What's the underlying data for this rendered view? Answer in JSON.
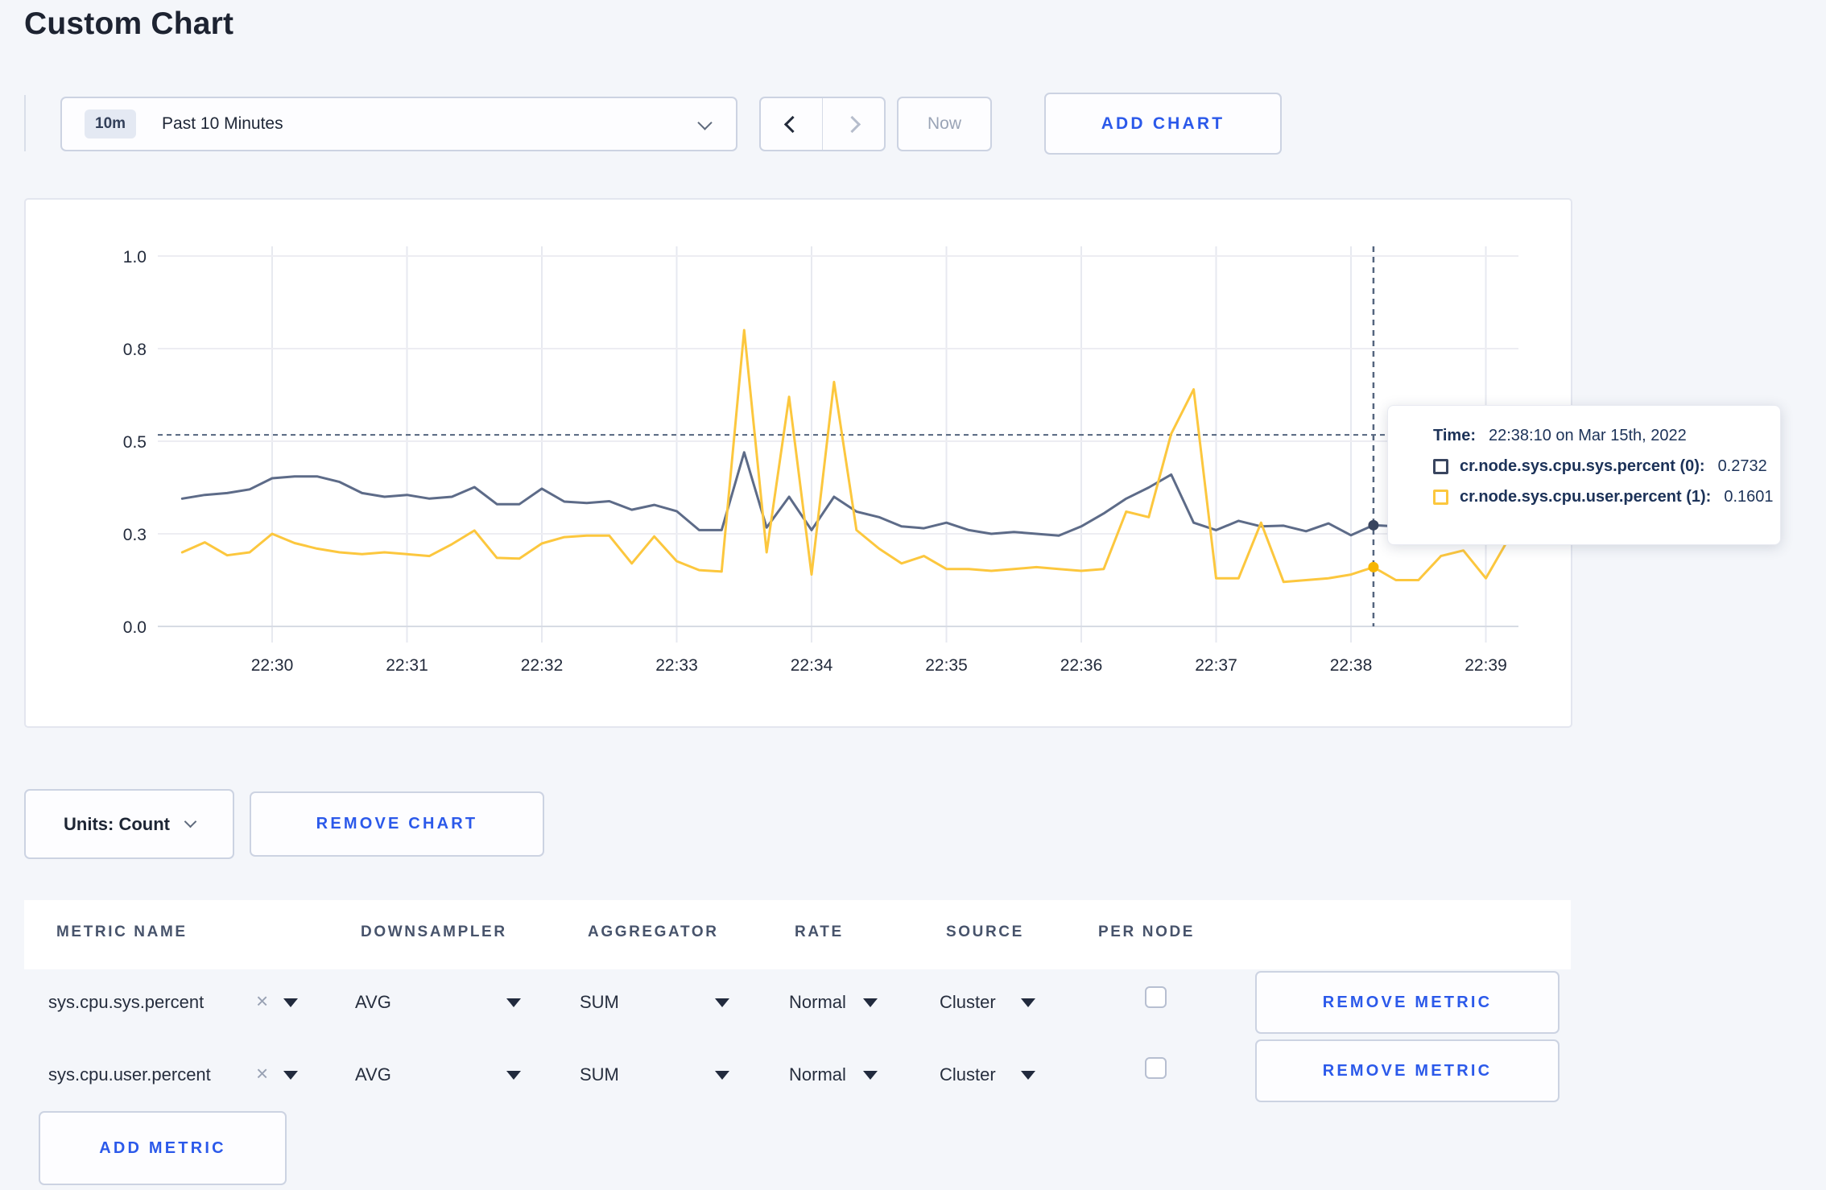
{
  "page": {
    "title": "Custom Chart"
  },
  "toolbar": {
    "time_badge": "10m",
    "time_label": "Past 10 Minutes",
    "prev_icon": "chevron-left",
    "next_icon": "chevron-right",
    "now_label": "Now",
    "add_chart_label": "ADD CHART"
  },
  "chart_footer": {
    "units_label": "Units: Count",
    "remove_chart_label": "REMOVE CHART"
  },
  "tooltip": {
    "time_label": "Time:",
    "time_value": "22:38:10 on Mar 15th, 2022",
    "series": [
      {
        "label": "cr.node.sys.cpu.sys.percent (0):",
        "value": "0.2732"
      },
      {
        "label": "cr.node.sys.cpu.user.percent (1):",
        "value": "0.1601"
      }
    ]
  },
  "metrics_table": {
    "headers": [
      "METRIC NAME",
      "DOWNSAMPLER",
      "AGGREGATOR",
      "RATE",
      "SOURCE",
      "PER NODE"
    ],
    "rows": [
      {
        "name": "sys.cpu.sys.percent",
        "downsampler": "AVG",
        "aggregator": "SUM",
        "rate": "Normal",
        "source": "Cluster",
        "per_node_checked": false
      },
      {
        "name": "sys.cpu.user.percent",
        "downsampler": "AVG",
        "aggregator": "SUM",
        "rate": "Normal",
        "source": "Cluster",
        "per_node_checked": false
      }
    ],
    "remove_metric_label": "REMOVE METRIC",
    "add_metric_label": "ADD METRIC"
  },
  "chart_data": {
    "type": "line",
    "title": "",
    "xlabel": "",
    "ylabel": "",
    "ylim": [
      0,
      1
    ],
    "x_start_time": "22:29:20",
    "x_step_seconds": 10,
    "x_ticks": [
      "22:30",
      "22:31",
      "22:32",
      "22:33",
      "22:34",
      "22:35",
      "22:36",
      "22:37",
      "22:38",
      "22:39"
    ],
    "y_ticks": [
      {
        "value": 0.0,
        "label": "0.0"
      },
      {
        "value": 0.25,
        "label": "0.3"
      },
      {
        "value": 0.5,
        "label": "0.5"
      },
      {
        "value": 0.75,
        "label": "0.8"
      },
      {
        "value": 1.0,
        "label": "1.0"
      }
    ],
    "grid": true,
    "legend_position": "tooltip-only",
    "series": [
      {
        "name": "cr.node.sys.cpu.sys.percent",
        "color": "#5d6b88",
        "dot_color": "#39455f",
        "values": [
          0.345,
          0.355,
          0.36,
          0.37,
          0.4,
          0.405,
          0.405,
          0.39,
          0.36,
          0.35,
          0.355,
          0.345,
          0.35,
          0.376,
          0.33,
          0.33,
          0.372,
          0.337,
          0.333,
          0.338,
          0.315,
          0.328,
          0.311,
          0.26,
          0.26,
          0.47,
          0.267,
          0.35,
          0.26,
          0.35,
          0.31,
          0.295,
          0.27,
          0.265,
          0.28,
          0.26,
          0.25,
          0.255,
          0.25,
          0.245,
          0.27,
          0.305,
          0.345,
          0.375,
          0.41,
          0.28,
          0.26,
          0.285,
          0.27,
          0.272,
          0.257,
          0.278,
          0.246,
          0.2732,
          0.27,
          0.28,
          0.27,
          0.265,
          0.28,
          0.27
        ]
      },
      {
        "name": "cr.node.sys.cpu.user.percent",
        "color": "#fcc73e",
        "dot_color": "#f7b500",
        "values": [
          0.2,
          0.227,
          0.192,
          0.2,
          0.25,
          0.225,
          0.21,
          0.2,
          0.195,
          0.2,
          0.195,
          0.19,
          0.222,
          0.259,
          0.185,
          0.183,
          0.224,
          0.241,
          0.245,
          0.245,
          0.17,
          0.243,
          0.176,
          0.152,
          0.148,
          0.8,
          0.2,
          0.62,
          0.14,
          0.66,
          0.26,
          0.21,
          0.17,
          0.19,
          0.155,
          0.155,
          0.15,
          0.155,
          0.16,
          0.155,
          0.15,
          0.155,
          0.31,
          0.295,
          0.52,
          0.64,
          0.13,
          0.13,
          0.28,
          0.12,
          0.125,
          0.13,
          0.14,
          0.1601,
          0.125,
          0.125,
          0.19,
          0.205,
          0.13,
          0.235
        ]
      }
    ],
    "crosshair": {
      "x_index": 53,
      "time": "22:38:10",
      "hover_value": 0.517,
      "point_values": [
        0.2732,
        0.1601
      ]
    }
  }
}
